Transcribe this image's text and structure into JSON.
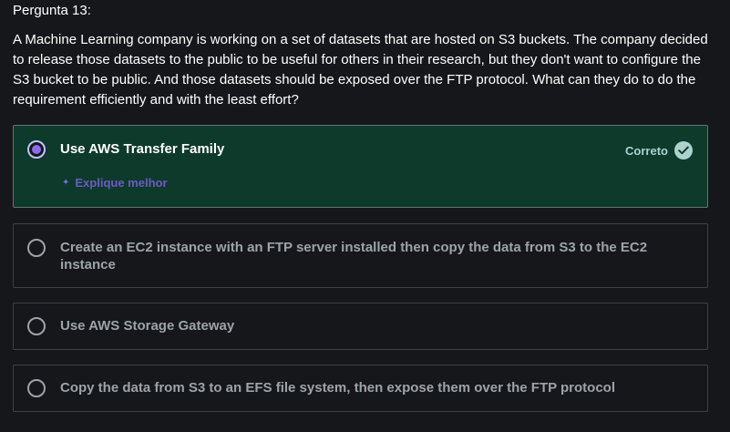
{
  "question": {
    "number_label": "Pergunta 13:",
    "text": "A Machine Learning company is working on a set of datasets that are hosted on S3 buckets. The company decided to release those datasets to the public to be useful for others in their research, but they don't want to configure the S3 bucket to be public. And those datasets should be exposed over the FTP protocol. What can they do to do the requirement efficiently and with the least effort?"
  },
  "options": [
    {
      "label": "Use AWS Transfer Family",
      "selected": true,
      "correct": true,
      "result_label": "Correto",
      "explain_label": "Explique melhor"
    },
    {
      "label": "Create an EC2 instance with an FTP server installed then copy the data from S3 to the EC2 instance",
      "selected": false
    },
    {
      "label": "Use AWS Storage Gateway",
      "selected": false
    },
    {
      "label": "Copy the data from S3 to an EFS file system, then expose them over the FTP protocol",
      "selected": false
    }
  ],
  "colors": {
    "background": "#16171b",
    "correct_background": "#0d3a2b",
    "correct_accent": "#acd2cc",
    "radio_selected": "#8b6cef",
    "explain_accent": "#6d5ac4"
  },
  "icons": {
    "radio": "radio-icon",
    "check": "check-circle-icon",
    "sparkle": "sparkle-icon"
  }
}
